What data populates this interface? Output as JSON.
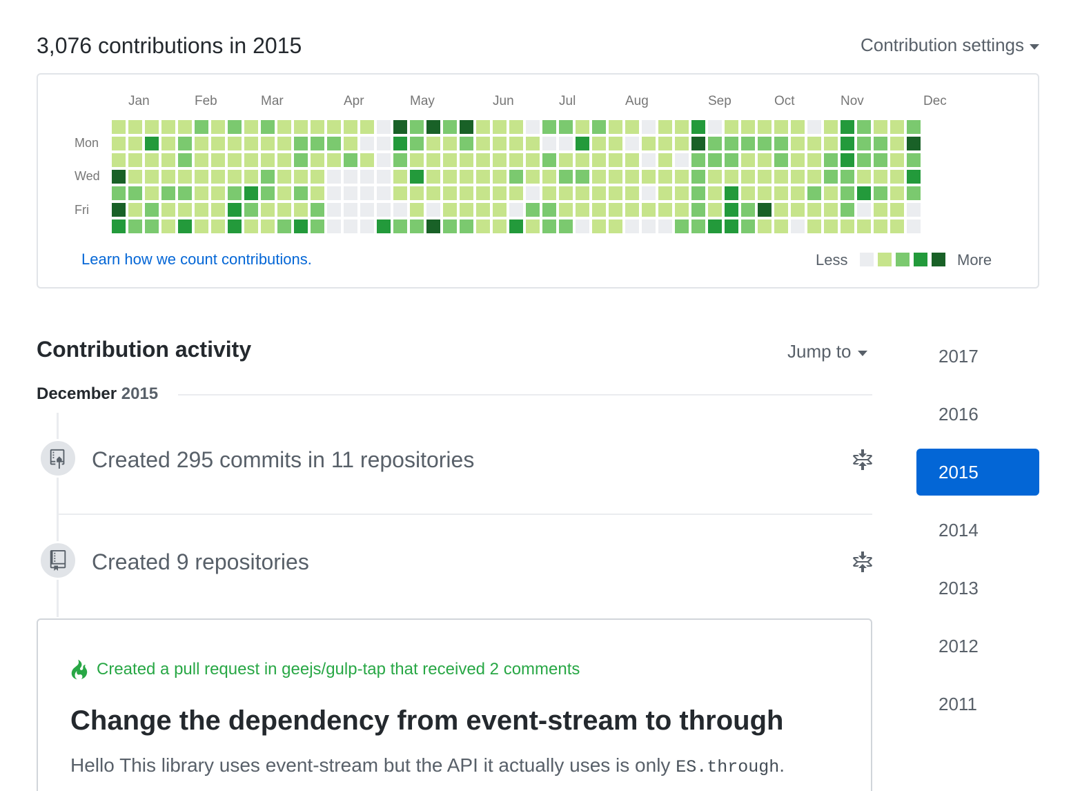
{
  "header": {
    "title": "3,076 contributions in 2015",
    "settings_label": "Contribution settings"
  },
  "calendar": {
    "months": [
      "Jan",
      "Feb",
      "Mar",
      "Apr",
      "May",
      "Jun",
      "Jul",
      "Aug",
      "Sep",
      "Oct",
      "Nov",
      "Dec"
    ],
    "day_labels": [
      "Mon",
      "Wed",
      "Fri"
    ],
    "learn_link": "Learn how we count contributions.",
    "legend_less": "Less",
    "legend_more": "More",
    "level_colors": [
      "#ebedf0",
      "#c6e48b",
      "#7bc96f",
      "#239a3b",
      "#196127"
    ],
    "weeks": [
      [
        1,
        1,
        1,
        4,
        2,
        4,
        3
      ],
      [
        1,
        1,
        1,
        1,
        2,
        1,
        2
      ],
      [
        1,
        3,
        1,
        1,
        1,
        2,
        2
      ],
      [
        1,
        1,
        1,
        1,
        2,
        1,
        1
      ],
      [
        1,
        2,
        2,
        1,
        2,
        1,
        3
      ],
      [
        2,
        1,
        1,
        1,
        1,
        1,
        1
      ],
      [
        1,
        1,
        1,
        1,
        1,
        1,
        1
      ],
      [
        2,
        1,
        1,
        1,
        2,
        3,
        3
      ],
      [
        1,
        1,
        1,
        1,
        3,
        2,
        1
      ],
      [
        2,
        1,
        1,
        2,
        2,
        1,
        1
      ],
      [
        1,
        1,
        1,
        1,
        1,
        1,
        2
      ],
      [
        1,
        2,
        2,
        1,
        2,
        1,
        3
      ],
      [
        1,
        2,
        1,
        1,
        1,
        2,
        2
      ],
      [
        1,
        2,
        1,
        0,
        0,
        0,
        0
      ],
      [
        1,
        1,
        2,
        0,
        0,
        0,
        0
      ],
      [
        1,
        0,
        1,
        0,
        0,
        0,
        0
      ],
      [
        0,
        0,
        0,
        0,
        0,
        0,
        3
      ],
      [
        4,
        3,
        2,
        1,
        1,
        0,
        2
      ],
      [
        2,
        2,
        1,
        3,
        1,
        1,
        2
      ],
      [
        4,
        1,
        1,
        1,
        1,
        0,
        4
      ],
      [
        2,
        1,
        1,
        1,
        1,
        1,
        2
      ],
      [
        4,
        2,
        1,
        1,
        1,
        1,
        2
      ],
      [
        1,
        1,
        1,
        1,
        1,
        1,
        1
      ],
      [
        1,
        1,
        1,
        1,
        1,
        1,
        1
      ],
      [
        1,
        1,
        1,
        2,
        1,
        0,
        3
      ],
      [
        0,
        1,
        1,
        1,
        0,
        2,
        1
      ],
      [
        2,
        0,
        2,
        1,
        1,
        2,
        2
      ],
      [
        2,
        0,
        1,
        2,
        1,
        1,
        2
      ],
      [
        1,
        3,
        1,
        2,
        1,
        1,
        0
      ],
      [
        2,
        1,
        1,
        1,
        1,
        1,
        1
      ],
      [
        1,
        1,
        1,
        1,
        1,
        1,
        1
      ],
      [
        1,
        0,
        1,
        1,
        1,
        1,
        0
      ],
      [
        0,
        1,
        0,
        1,
        0,
        1,
        0
      ],
      [
        1,
        1,
        1,
        1,
        1,
        1,
        0
      ],
      [
        1,
        1,
        0,
        1,
        1,
        1,
        2
      ],
      [
        3,
        4,
        2,
        2,
        2,
        2,
        2
      ],
      [
        0,
        2,
        2,
        1,
        1,
        1,
        3
      ],
      [
        1,
        2,
        2,
        1,
        3,
        3,
        3
      ],
      [
        1,
        2,
        1,
        1,
        1,
        2,
        2
      ],
      [
        1,
        2,
        1,
        1,
        1,
        4,
        1
      ],
      [
        1,
        2,
        2,
        1,
        1,
        1,
        1
      ],
      [
        1,
        1,
        1,
        1,
        1,
        1,
        0
      ],
      [
        0,
        1,
        1,
        1,
        2,
        1,
        1
      ],
      [
        1,
        1,
        2,
        2,
        1,
        1,
        1
      ],
      [
        3,
        3,
        3,
        2,
        2,
        2,
        1
      ],
      [
        2,
        2,
        2,
        1,
        3,
        0,
        1
      ],
      [
        1,
        2,
        2,
        1,
        2,
        1,
        1
      ],
      [
        1,
        1,
        1,
        1,
        1,
        1,
        1
      ],
      [
        2,
        4,
        2,
        3,
        2,
        0,
        0
      ]
    ]
  },
  "activity": {
    "title": "Contribution activity",
    "jump_label": "Jump to",
    "month_name": "December",
    "month_year": "2015",
    "items": [
      {
        "text": "Created 295 commits in 11 repositories",
        "icon": "repo-push-icon"
      },
      {
        "text": "Created 9 repositories",
        "icon": "repo-icon"
      }
    ],
    "pull_request": {
      "meta": "Created a pull request in geejs/gulp-tap that received 2 comments",
      "title": "Change the dependency from event-stream to through",
      "body_1": "Hello This library uses event-stream but the API it actually uses is only ",
      "body_code": "ES.through",
      "body_2": "."
    }
  },
  "years": {
    "items": [
      "2017",
      "2016",
      "2015",
      "2014",
      "2013",
      "2012",
      "2011"
    ],
    "active": "2015",
    "active_color": "#0366d6"
  }
}
